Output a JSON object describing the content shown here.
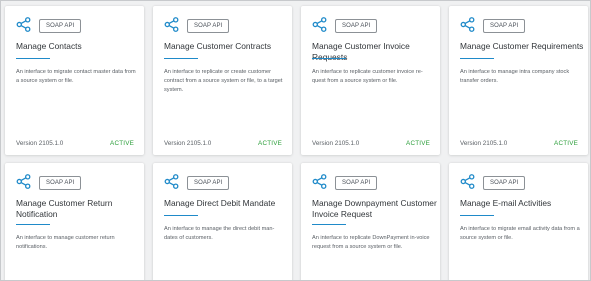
{
  "colors": {
    "accent": "#1f8ac9",
    "active": "#2b9e3a",
    "background": "#f0f1f2"
  },
  "cards": [
    {
      "icon": "share-icon",
      "badge": "SOAP API",
      "title": "Manage Contacts",
      "description": "An interface to migrate contact master data from a source system or file.",
      "version": "Version 2105.1.0",
      "status": "ACTIVE"
    },
    {
      "icon": "share-icon",
      "badge": "SOAP API",
      "title": "Manage Customer Contracts",
      "description": "An interface to replicate or create customer contract from a source system or file, to a target system.",
      "version": "Version 2105.1.0",
      "status": "ACTIVE"
    },
    {
      "icon": "share-icon",
      "badge": "SOAP API",
      "title": "Manage Customer Invoice Requests",
      "description": "An interface to replicate customer invoice re-quest from a source system or file.",
      "version": "Version 2105.1.0",
      "status": "ACTIVE"
    },
    {
      "icon": "share-icon",
      "badge": "SOAP API",
      "title": "Manage Customer Requirements",
      "description": "An interface to manage intra company stock transfer orders.",
      "version": "Version 2105.1.0",
      "status": "ACTIVE"
    },
    {
      "icon": "share-icon",
      "badge": "SOAP API",
      "title": "Manage Customer Return Notification",
      "description": "An interface to manage customer return notifications."
    },
    {
      "icon": "share-icon",
      "badge": "SOAP API",
      "title": "Manage Direct Debit Mandate",
      "description": "An interface to manage the direct debit man-dates of customers."
    },
    {
      "icon": "share-icon",
      "badge": "SOAP API",
      "title": "Manage Downpayment Customer Invoice Request",
      "description": "An interface to replicate DownPayment in-voice request from a source system or file."
    },
    {
      "icon": "share-icon",
      "badge": "SOAP API",
      "title": "Manage E-mail Activities",
      "description": "An interface to migrate email activity data from a source system or file."
    }
  ]
}
